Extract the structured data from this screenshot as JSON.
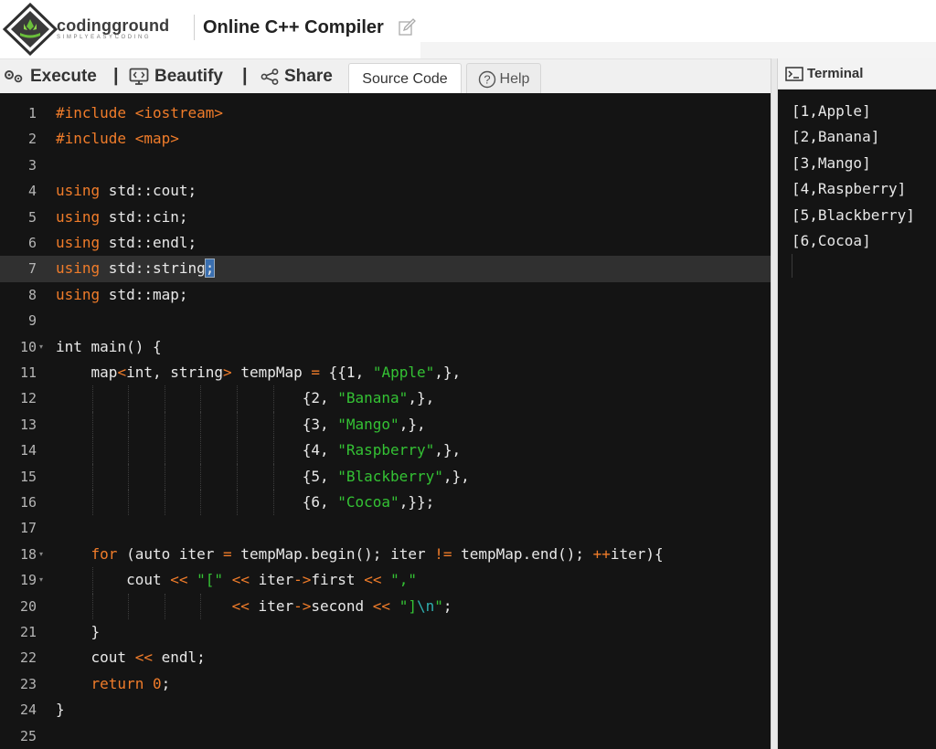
{
  "header": {
    "brand": "codingground",
    "tagline": "SIMPLYEASYCODING",
    "title": "Online C++ Compiler"
  },
  "toolbar": {
    "execute_label": "Execute",
    "separator": "|",
    "beautify_label": "Beautify",
    "share_label": "Share",
    "tab_source": "Source Code",
    "tab_help": "Help"
  },
  "editor": {
    "active_line": 7,
    "lines": [
      {
        "n": "1",
        "fold": false
      },
      {
        "n": "2",
        "fold": false
      },
      {
        "n": "3",
        "fold": false
      },
      {
        "n": "4",
        "fold": false
      },
      {
        "n": "5",
        "fold": false
      },
      {
        "n": "6",
        "fold": false
      },
      {
        "n": "7",
        "fold": false
      },
      {
        "n": "8",
        "fold": false
      },
      {
        "n": "9",
        "fold": false
      },
      {
        "n": "10",
        "fold": true
      },
      {
        "n": "11",
        "fold": false
      },
      {
        "n": "12",
        "fold": false
      },
      {
        "n": "13",
        "fold": false
      },
      {
        "n": "14",
        "fold": false
      },
      {
        "n": "15",
        "fold": false
      },
      {
        "n": "16",
        "fold": false
      },
      {
        "n": "17",
        "fold": false
      },
      {
        "n": "18",
        "fold": true
      },
      {
        "n": "19",
        "fold": true
      },
      {
        "n": "20",
        "fold": false
      },
      {
        "n": "21",
        "fold": false
      },
      {
        "n": "22",
        "fold": false
      },
      {
        "n": "23",
        "fold": false
      },
      {
        "n": "24",
        "fold": false
      },
      {
        "n": "25",
        "fold": false
      }
    ],
    "code": [
      [
        {
          "t": "#include ",
          "c": "inc"
        },
        {
          "t": "<iostream>",
          "c": "hdr"
        }
      ],
      [
        {
          "t": "#include ",
          "c": "inc"
        },
        {
          "t": "<map>",
          "c": "hdr"
        }
      ],
      [],
      [
        {
          "t": "using",
          "c": "kw"
        },
        {
          "t": " std::cout;",
          "c": ""
        }
      ],
      [
        {
          "t": "using",
          "c": "kw"
        },
        {
          "t": " std::cin;",
          "c": ""
        }
      ],
      [
        {
          "t": "using",
          "c": "kw"
        },
        {
          "t": " std::endl;",
          "c": ""
        }
      ],
      [
        {
          "t": "using",
          "c": "kw"
        },
        {
          "t": " std::string",
          "c": ""
        },
        {
          "t": ";",
          "c": "sel"
        }
      ],
      [
        {
          "t": "using",
          "c": "kw"
        },
        {
          "t": " std::map;",
          "c": ""
        }
      ],
      [],
      [
        {
          "t": "int main() {",
          "c": ""
        }
      ],
      [
        {
          "t": "    map",
          "c": ""
        },
        {
          "t": "<",
          "c": "op"
        },
        {
          "t": "int, string",
          "c": ""
        },
        {
          "t": ">",
          "c": "op"
        },
        {
          "t": " tempMap ",
          "c": ""
        },
        {
          "t": "=",
          "c": "op"
        },
        {
          "t": " {{1, ",
          "c": ""
        },
        {
          "t": "\"Apple\"",
          "c": "str"
        },
        {
          "t": ",},",
          "c": ""
        }
      ],
      [
        {
          "t": "                            {2, ",
          "c": ""
        },
        {
          "t": "\"Banana\"",
          "c": "str"
        },
        {
          "t": ",},",
          "c": ""
        }
      ],
      [
        {
          "t": "                            {3, ",
          "c": ""
        },
        {
          "t": "\"Mango\"",
          "c": "str"
        },
        {
          "t": ",},",
          "c": ""
        }
      ],
      [
        {
          "t": "                            {4, ",
          "c": ""
        },
        {
          "t": "\"Raspberry\"",
          "c": "str"
        },
        {
          "t": ",},",
          "c": ""
        }
      ],
      [
        {
          "t": "                            {5, ",
          "c": ""
        },
        {
          "t": "\"Blackberry\"",
          "c": "str"
        },
        {
          "t": ",},",
          "c": ""
        }
      ],
      [
        {
          "t": "                            {6, ",
          "c": ""
        },
        {
          "t": "\"Cocoa\"",
          "c": "str"
        },
        {
          "t": ",}};",
          "c": ""
        }
      ],
      [],
      [
        {
          "t": "    ",
          "c": ""
        },
        {
          "t": "for",
          "c": "kw"
        },
        {
          "t": " (auto iter ",
          "c": ""
        },
        {
          "t": "=",
          "c": "op"
        },
        {
          "t": " tempMap.begin(); iter ",
          "c": ""
        },
        {
          "t": "!=",
          "c": "op"
        },
        {
          "t": " tempMap.end(); ",
          "c": ""
        },
        {
          "t": "++",
          "c": "op"
        },
        {
          "t": "iter){",
          "c": ""
        }
      ],
      [
        {
          "t": "        cout ",
          "c": ""
        },
        {
          "t": "<<",
          "c": "op"
        },
        {
          "t": " ",
          "c": ""
        },
        {
          "t": "\"[\"",
          "c": "str"
        },
        {
          "t": " ",
          "c": ""
        },
        {
          "t": "<<",
          "c": "op"
        },
        {
          "t": " iter",
          "c": ""
        },
        {
          "t": "->",
          "c": "op"
        },
        {
          "t": "first ",
          "c": ""
        },
        {
          "t": "<<",
          "c": "op"
        },
        {
          "t": " ",
          "c": ""
        },
        {
          "t": "\",\"",
          "c": "str"
        }
      ],
      [
        {
          "t": "                    ",
          "c": ""
        },
        {
          "t": "<<",
          "c": "op"
        },
        {
          "t": " iter",
          "c": ""
        },
        {
          "t": "->",
          "c": "op"
        },
        {
          "t": "second ",
          "c": ""
        },
        {
          "t": "<<",
          "c": "op"
        },
        {
          "t": " ",
          "c": ""
        },
        {
          "t": "\"]",
          "c": "str"
        },
        {
          "t": "\\n",
          "c": "esc"
        },
        {
          "t": "\"",
          "c": "str"
        },
        {
          "t": ";",
          "c": ""
        }
      ],
      [
        {
          "t": "    }",
          "c": ""
        }
      ],
      [
        {
          "t": "    cout ",
          "c": ""
        },
        {
          "t": "<<",
          "c": "op"
        },
        {
          "t": " endl;",
          "c": ""
        }
      ],
      [
        {
          "t": "    ",
          "c": ""
        },
        {
          "t": "return",
          "c": "kw"
        },
        {
          "t": " ",
          "c": ""
        },
        {
          "t": "0",
          "c": "num"
        },
        {
          "t": ";",
          "c": ""
        }
      ],
      [
        {
          "t": "}",
          "c": ""
        }
      ],
      []
    ]
  },
  "terminal": {
    "title": "Terminal",
    "output": [
      "[1,Apple]",
      "[2,Banana]",
      "[3,Mango]",
      "[4,Raspberry]",
      "[5,Blackberry]",
      "[6,Cocoa]"
    ]
  },
  "colors": {
    "editor_bg": "#141414",
    "keyword": "#f07c2a",
    "string": "#34c234",
    "escape": "#2fb0b0",
    "active_line": "#303030"
  }
}
